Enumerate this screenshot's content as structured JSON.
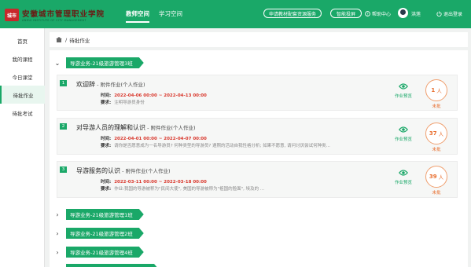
{
  "header": {
    "logo_seal": "城市",
    "logo_name": "安徽城市管理职业学院",
    "logo_english": "ANHUI INSTITUTE OF CITY MANAGEMENT",
    "tabs": [
      {
        "label": "教师空间",
        "active": true
      },
      {
        "label": "学习空间",
        "active": false
      }
    ],
    "apply_textbook_label": "申请教材配套资源服务",
    "smart_screen_label": "智能投屏",
    "help_label": "帮助中心",
    "username": "洪莲",
    "logout_label": "退出登录",
    "accent_color": "#1aa868"
  },
  "sidebar": {
    "items": [
      {
        "label": "首页",
        "active": false
      },
      {
        "label": "我的课程",
        "active": false
      },
      {
        "label": "今日课堂",
        "active": false
      },
      {
        "label": "待批作业",
        "active": true
      },
      {
        "label": "待批考试",
        "active": false
      }
    ]
  },
  "breadcrumb": {
    "separator": "/",
    "current": "待批作业"
  },
  "groups": [
    {
      "label": "导游业务-21级旅游管理3班",
      "expanded": true
    },
    {
      "label": "导游业务-21级旅游管理1班",
      "expanded": false
    },
    {
      "label": "导游业务-21级旅游管理2班",
      "expanded": false
    },
    {
      "label": "导游业务-21级旅游管理4班",
      "expanded": false
    }
  ],
  "assignments": [
    {
      "index": "1",
      "title": "欢迎辞",
      "kind": " - 附件作业(个人作业)",
      "time_label": "时间:",
      "time": "2022-04-06 00:00 ~ 2022-04-13 00:00",
      "req_label": "要求:",
      "requirement": "注明导游员身份",
      "preview_label": "作业预览",
      "count": "1",
      "count_unit": "人",
      "status": "未批"
    },
    {
      "index": "2",
      "title": "对导游人员的理解和认识",
      "kind": " - 附件作业(个人作业)",
      "time_label": "时间:",
      "time": "2022-04-01 00:00 ~ 2022-04-07 00:00",
      "req_label": "要求:",
      "requirement": "请你是否愿意成为一名导游员? 何种类型的导游员? 遵照的活动自我性格分析; 如果不愿意, 请问讨厌尝试何种类...",
      "preview_label": "作业预览",
      "count": "37",
      "count_unit": "人",
      "status": "未批"
    },
    {
      "index": "3",
      "title": "导游服务的认识",
      "kind": " - 附件作业(个人作业)",
      "time_label": "时间:",
      "time": "2022-03-11 00:00 ~ 2022-03-18 00:00",
      "req_label": "要求:",
      "requirement": "作业:我国的导游被称为\"民间大使\", 美国的导游被称为\"祖国的脸面\", 埃及的 ...",
      "preview_label": "作业预览",
      "count": "39",
      "count_unit": "人",
      "status": "未批"
    }
  ]
}
